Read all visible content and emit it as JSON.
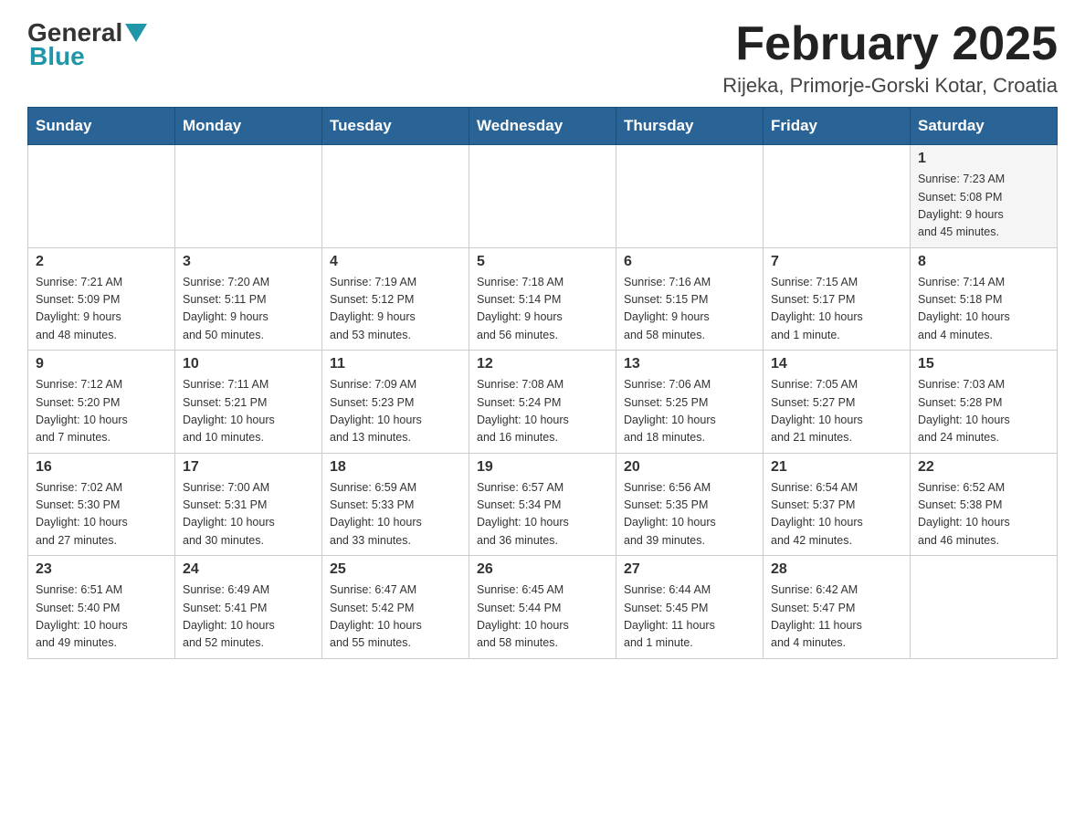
{
  "header": {
    "logo_general": "General",
    "logo_blue": "Blue",
    "title": "February 2025",
    "location": "Rijeka, Primorje-Gorski Kotar, Croatia"
  },
  "days_of_week": [
    "Sunday",
    "Monday",
    "Tuesday",
    "Wednesday",
    "Thursday",
    "Friday",
    "Saturday"
  ],
  "weeks": [
    [
      {
        "day": "",
        "info": ""
      },
      {
        "day": "",
        "info": ""
      },
      {
        "day": "",
        "info": ""
      },
      {
        "day": "",
        "info": ""
      },
      {
        "day": "",
        "info": ""
      },
      {
        "day": "",
        "info": ""
      },
      {
        "day": "1",
        "info": "Sunrise: 7:23 AM\nSunset: 5:08 PM\nDaylight: 9 hours\nand 45 minutes."
      }
    ],
    [
      {
        "day": "2",
        "info": "Sunrise: 7:21 AM\nSunset: 5:09 PM\nDaylight: 9 hours\nand 48 minutes."
      },
      {
        "day": "3",
        "info": "Sunrise: 7:20 AM\nSunset: 5:11 PM\nDaylight: 9 hours\nand 50 minutes."
      },
      {
        "day": "4",
        "info": "Sunrise: 7:19 AM\nSunset: 5:12 PM\nDaylight: 9 hours\nand 53 minutes."
      },
      {
        "day": "5",
        "info": "Sunrise: 7:18 AM\nSunset: 5:14 PM\nDaylight: 9 hours\nand 56 minutes."
      },
      {
        "day": "6",
        "info": "Sunrise: 7:16 AM\nSunset: 5:15 PM\nDaylight: 9 hours\nand 58 minutes."
      },
      {
        "day": "7",
        "info": "Sunrise: 7:15 AM\nSunset: 5:17 PM\nDaylight: 10 hours\nand 1 minute."
      },
      {
        "day": "8",
        "info": "Sunrise: 7:14 AM\nSunset: 5:18 PM\nDaylight: 10 hours\nand 4 minutes."
      }
    ],
    [
      {
        "day": "9",
        "info": "Sunrise: 7:12 AM\nSunset: 5:20 PM\nDaylight: 10 hours\nand 7 minutes."
      },
      {
        "day": "10",
        "info": "Sunrise: 7:11 AM\nSunset: 5:21 PM\nDaylight: 10 hours\nand 10 minutes."
      },
      {
        "day": "11",
        "info": "Sunrise: 7:09 AM\nSunset: 5:23 PM\nDaylight: 10 hours\nand 13 minutes."
      },
      {
        "day": "12",
        "info": "Sunrise: 7:08 AM\nSunset: 5:24 PM\nDaylight: 10 hours\nand 16 minutes."
      },
      {
        "day": "13",
        "info": "Sunrise: 7:06 AM\nSunset: 5:25 PM\nDaylight: 10 hours\nand 18 minutes."
      },
      {
        "day": "14",
        "info": "Sunrise: 7:05 AM\nSunset: 5:27 PM\nDaylight: 10 hours\nand 21 minutes."
      },
      {
        "day": "15",
        "info": "Sunrise: 7:03 AM\nSunset: 5:28 PM\nDaylight: 10 hours\nand 24 minutes."
      }
    ],
    [
      {
        "day": "16",
        "info": "Sunrise: 7:02 AM\nSunset: 5:30 PM\nDaylight: 10 hours\nand 27 minutes."
      },
      {
        "day": "17",
        "info": "Sunrise: 7:00 AM\nSunset: 5:31 PM\nDaylight: 10 hours\nand 30 minutes."
      },
      {
        "day": "18",
        "info": "Sunrise: 6:59 AM\nSunset: 5:33 PM\nDaylight: 10 hours\nand 33 minutes."
      },
      {
        "day": "19",
        "info": "Sunrise: 6:57 AM\nSunset: 5:34 PM\nDaylight: 10 hours\nand 36 minutes."
      },
      {
        "day": "20",
        "info": "Sunrise: 6:56 AM\nSunset: 5:35 PM\nDaylight: 10 hours\nand 39 minutes."
      },
      {
        "day": "21",
        "info": "Sunrise: 6:54 AM\nSunset: 5:37 PM\nDaylight: 10 hours\nand 42 minutes."
      },
      {
        "day": "22",
        "info": "Sunrise: 6:52 AM\nSunset: 5:38 PM\nDaylight: 10 hours\nand 46 minutes."
      }
    ],
    [
      {
        "day": "23",
        "info": "Sunrise: 6:51 AM\nSunset: 5:40 PM\nDaylight: 10 hours\nand 49 minutes."
      },
      {
        "day": "24",
        "info": "Sunrise: 6:49 AM\nSunset: 5:41 PM\nDaylight: 10 hours\nand 52 minutes."
      },
      {
        "day": "25",
        "info": "Sunrise: 6:47 AM\nSunset: 5:42 PM\nDaylight: 10 hours\nand 55 minutes."
      },
      {
        "day": "26",
        "info": "Sunrise: 6:45 AM\nSunset: 5:44 PM\nDaylight: 10 hours\nand 58 minutes."
      },
      {
        "day": "27",
        "info": "Sunrise: 6:44 AM\nSunset: 5:45 PM\nDaylight: 11 hours\nand 1 minute."
      },
      {
        "day": "28",
        "info": "Sunrise: 6:42 AM\nSunset: 5:47 PM\nDaylight: 11 hours\nand 4 minutes."
      },
      {
        "day": "",
        "info": ""
      }
    ]
  ]
}
